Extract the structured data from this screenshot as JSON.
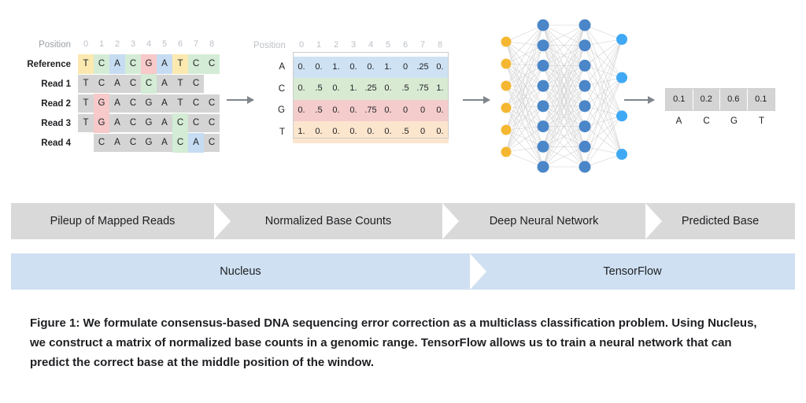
{
  "pileup": {
    "position_label": "Position",
    "positions": [
      "0",
      "1",
      "2",
      "3",
      "4",
      "5",
      "6",
      "7",
      "8"
    ],
    "rows": [
      {
        "label": "Reference",
        "start": 0,
        "bases": [
          "T",
          "C",
          "A",
          "C",
          "G",
          "A",
          "T",
          "C",
          "C"
        ],
        "highlight_all": true,
        "highlights": []
      },
      {
        "label": "Read 1",
        "start": 0,
        "bases": [
          "T",
          "C",
          "A",
          "C",
          "C",
          "A",
          "T",
          "C"
        ],
        "highlight_all": false,
        "highlights": [
          4
        ]
      },
      {
        "label": "Read 2",
        "start": 0,
        "bases": [
          "T",
          "G",
          "A",
          "C",
          "G",
          "A",
          "T",
          "C",
          "C"
        ],
        "highlight_all": false,
        "highlights": [
          1
        ]
      },
      {
        "label": "Read 3",
        "start": 0,
        "bases": [
          "T",
          "G",
          "A",
          "C",
          "G",
          "A",
          "C",
          "C",
          "C"
        ],
        "highlight_all": false,
        "highlights": [
          1,
          6
        ]
      },
      {
        "label": "Read 4",
        "start": 1,
        "bases": [
          "C",
          "A",
          "C",
          "G",
          "A",
          "C",
          "A",
          "C"
        ],
        "highlight_all": false,
        "highlights": [
          6,
          7
        ]
      }
    ]
  },
  "matrix": {
    "position_label": "Position",
    "positions": [
      "0",
      "1",
      "2",
      "3",
      "4",
      "5",
      "6",
      "7",
      "8"
    ],
    "rows": [
      {
        "base": "A",
        "values": [
          "0.",
          "0.",
          "1.",
          "0.",
          "0.",
          "1.",
          "0",
          ".25",
          "0."
        ]
      },
      {
        "base": "C",
        "values": [
          "0.",
          ".5",
          "0.",
          "1.",
          ".25",
          "0.",
          ".5",
          ".75",
          "1."
        ]
      },
      {
        "base": "G",
        "values": [
          "0.",
          ".5",
          "0.",
          "0.",
          ".75",
          "0.",
          "0",
          "0",
          "0."
        ]
      },
      {
        "base": "T",
        "values": [
          "1.",
          "0.",
          "0.",
          "0.",
          "0.",
          "0.",
          ".5",
          "0",
          "0."
        ]
      }
    ]
  },
  "network": {
    "input_nodes": 6,
    "hidden_layer_1_nodes": 8,
    "hidden_layer_2_nodes": 8,
    "output_nodes": 4,
    "input_color": "#f5b731",
    "hidden_color": "#4a86c8",
    "output_color": "#3fa9f5",
    "edge_color": "#cfcfcf"
  },
  "prediction": {
    "values": [
      "0.1",
      "0.2",
      "0.6",
      "0.1"
    ],
    "labels": [
      "A",
      "C",
      "G",
      "T"
    ]
  },
  "banners": {
    "stages": [
      "Pileup of Mapped Reads",
      "Normalized Base Counts",
      "Deep Neural Network",
      "Predicted Base"
    ],
    "tools": [
      "Nucleus",
      "TensorFlow"
    ]
  },
  "caption": {
    "text": "Figure 1: We formulate consensus-based DNA sequencing error correction as a multiclass classification problem. Using Nucleus, we construct a matrix of normalized base counts in a genomic range. TensorFlow allows us to train a neural network that can predict the correct base at the middle position of the window."
  }
}
